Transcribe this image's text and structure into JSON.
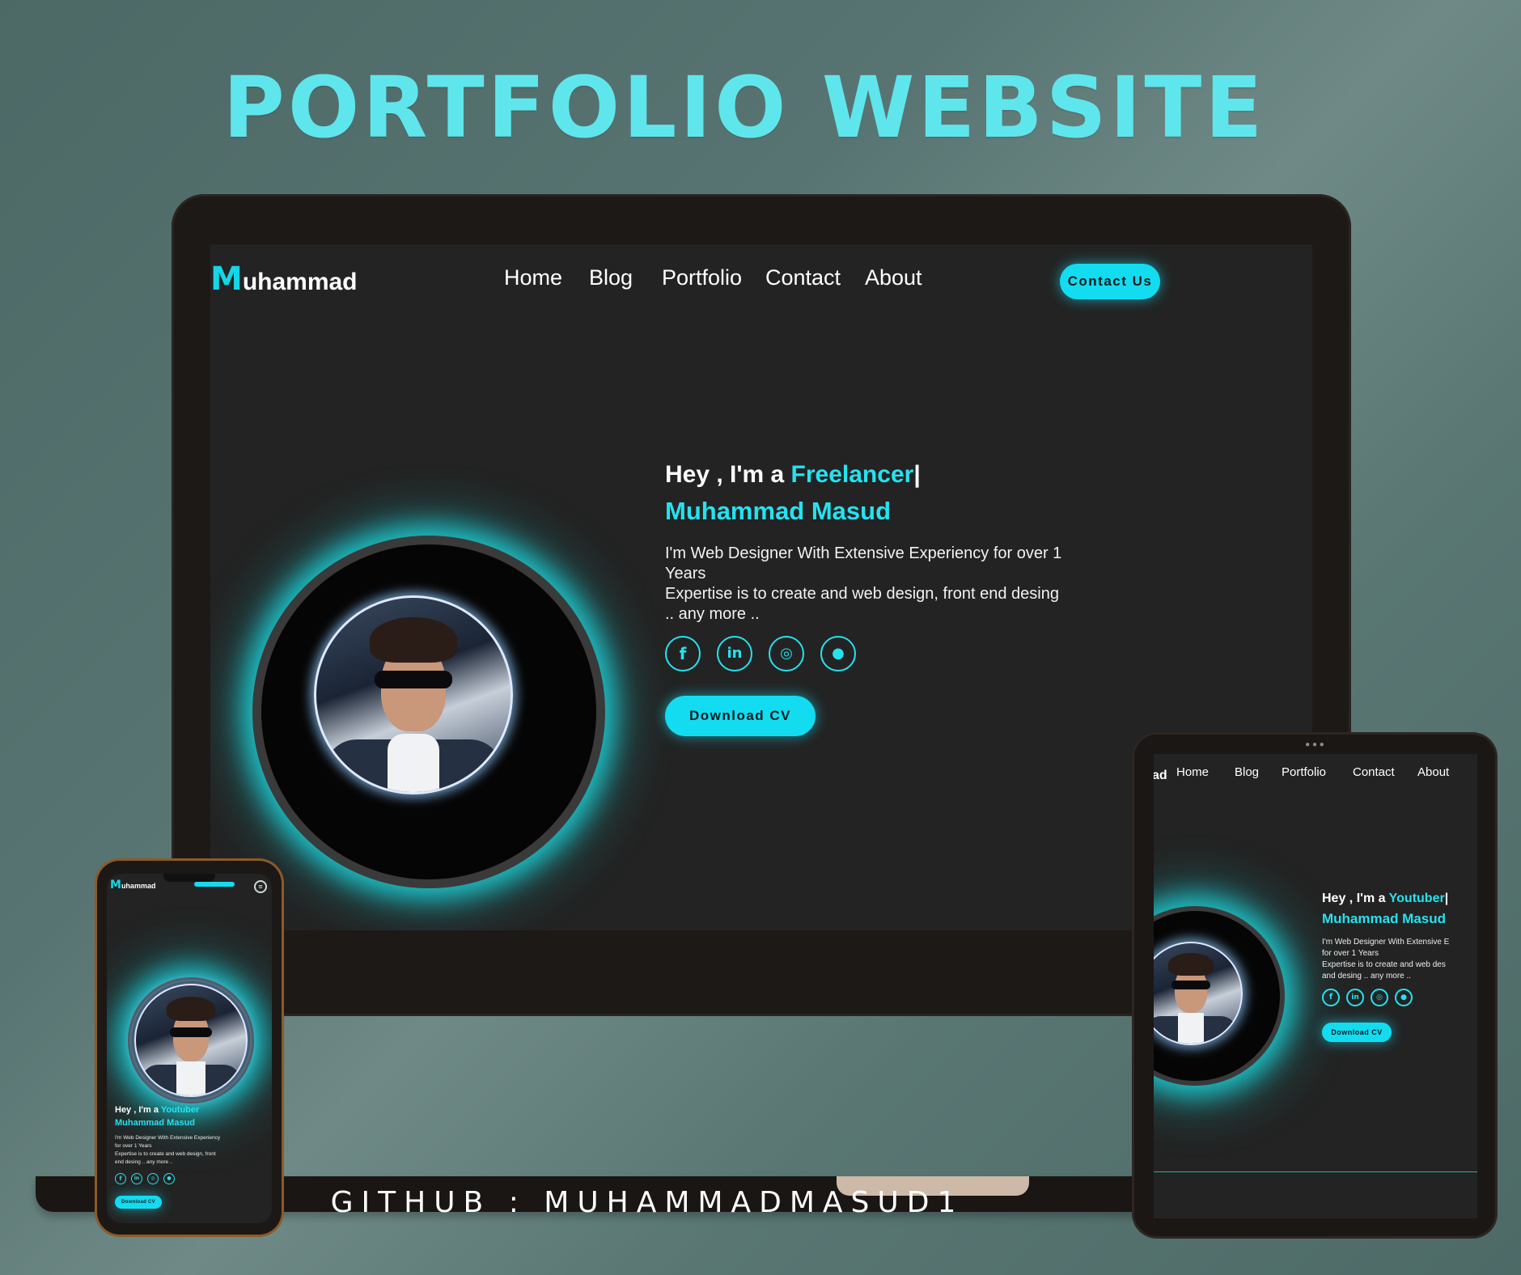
{
  "banner": {
    "title": "PORTFOLIO WEBSITE"
  },
  "footer": {
    "github": "GITHUB : MUHAMMADMASUD1"
  },
  "colors": {
    "accent": "#25e2ef",
    "screen_bg": "#232323",
    "device_frame": "#1d1917"
  },
  "laptop": {
    "logo_initial": "M",
    "logo_rest": "uhammad",
    "nav": [
      "Home",
      "Blog",
      "Portfolio",
      "Contact",
      "About"
    ],
    "contact_button": "Contact Us",
    "greeting": "Hey , I'm a",
    "role": "Freelancer",
    "name": "Muhammad Masud",
    "description_line1": "I'm Web Designer With Extensive Experiency for over 1",
    "description_line2": "Years",
    "description_line3": "Expertise is to create and web design, front end desing",
    "description_line4": ".. any more ..",
    "socials": [
      "facebook-icon",
      "linkedin-icon",
      "instagram-icon",
      "github-icon"
    ],
    "download_button": "Download CV"
  },
  "tablet": {
    "logo_fragment": "ad",
    "nav": [
      "Home",
      "Blog",
      "Portfolio",
      "Contact",
      "About"
    ],
    "greeting": "Hey , I'm a",
    "role": "Youtuber",
    "name": "Muhammad Masud",
    "description_line1": "I'm Web Designer With Extensive E",
    "description_line2": "for over 1 Years",
    "description_line3": "Expertise is to create and web des",
    "description_line4": "and desing .. any more ..",
    "download_button": "Download CV"
  },
  "phone": {
    "logo_initial": "M",
    "logo_rest": "uhammad",
    "greeting": "Hey , I'm a",
    "role": "Youtuber",
    "name": "Muhammad Masud",
    "description_line1": "I'm Web Designer With Extensive Experiency",
    "description_line2": "for over 1 Years",
    "description_line3": "Expertise is to create and web design, front",
    "description_line4": "end desing .. any more ..",
    "download_button": "Download CV"
  }
}
